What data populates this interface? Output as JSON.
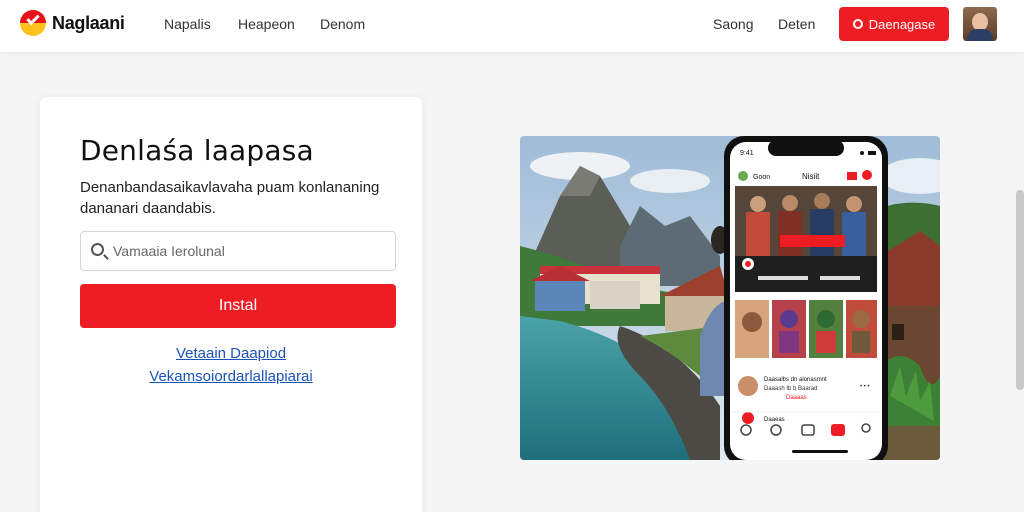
{
  "header": {
    "logo_text": "Naglaani",
    "nav": [
      "Napalis",
      "Heapeon",
      "Denom"
    ],
    "right_links": [
      "Saong",
      "Deten"
    ],
    "cta_label": "Daenagase"
  },
  "card": {
    "title": "Denlaśa laapasa",
    "description": "Denanbandasaikavlavaha puam konlananing dananari daandabis.",
    "search_placeholder": "Vamaaia Ierolunal",
    "install_label": "Instal",
    "link_1": "Vetaain Daapiod",
    "link_2": "Vekamsoiordarlallapiarai"
  },
  "phone": {
    "app_title": "Nisiit",
    "app_label": "Goon",
    "list_items": [
      {
        "title": "Daasalbs dn alonasmnt",
        "sub": "Daaash Ib b Baarad",
        "meta": "Daaaas"
      },
      {
        "title": "Daaeas",
        "sub": "",
        "meta": ""
      }
    ]
  },
  "colors": {
    "brand_red": "#ee1c23",
    "link_blue": "#1a54b8"
  }
}
